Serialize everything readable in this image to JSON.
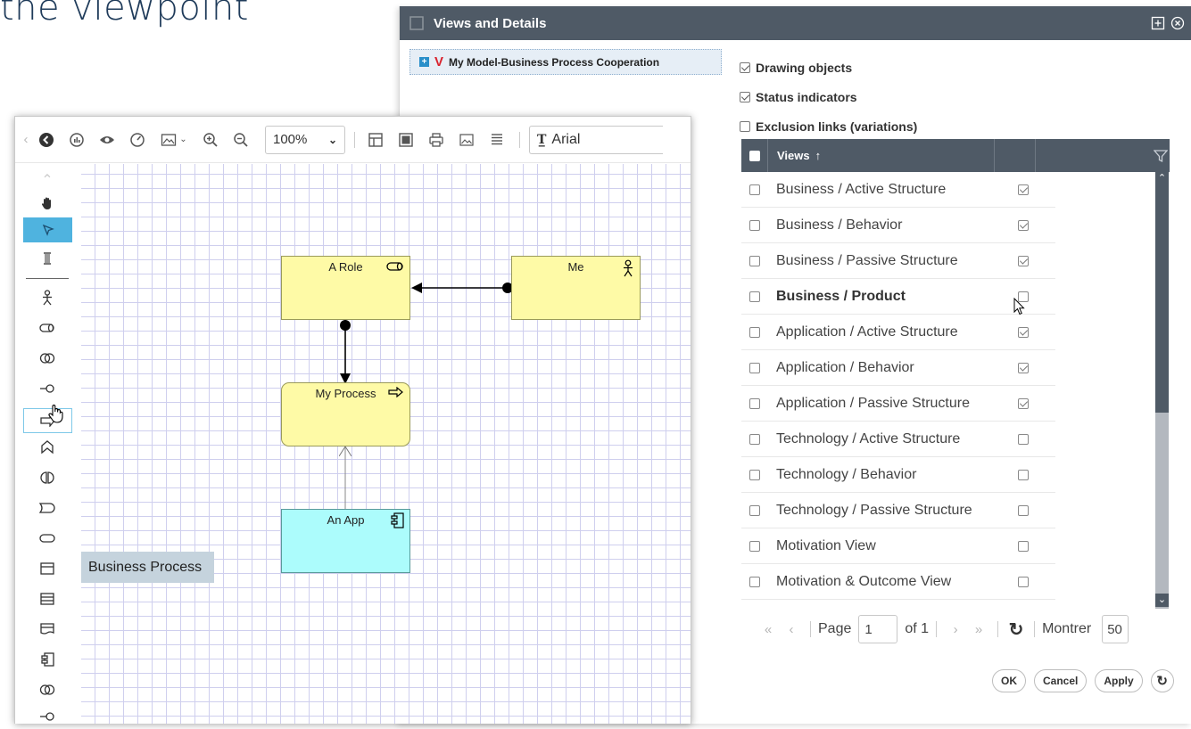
{
  "background": {
    "title_fragment": "the viewpoint"
  },
  "dialog": {
    "title": "Views and Details",
    "tree_item": "My Model-Business Process Cooperation",
    "options": [
      {
        "label": "Drawing objects",
        "checked": true
      },
      {
        "label": "Status indicators",
        "checked": true
      },
      {
        "label": "Exclusion links (variations)",
        "checked": false
      }
    ],
    "grid": {
      "column_views": "Views",
      "rows": [
        {
          "label": "Business / Active Structure",
          "checked": true,
          "bold": false
        },
        {
          "label": "Business / Behavior",
          "checked": true,
          "bold": false
        },
        {
          "label": "Business / Passive Structure",
          "checked": true,
          "bold": false
        },
        {
          "label": "Business / Product",
          "checked": false,
          "bold": true
        },
        {
          "label": "Application / Active Structure",
          "checked": true,
          "bold": false
        },
        {
          "label": "Application / Behavior",
          "checked": true,
          "bold": false
        },
        {
          "label": "Application / Passive Structure",
          "checked": true,
          "bold": false
        },
        {
          "label": "Technology / Active Structure",
          "checked": false,
          "bold": false
        },
        {
          "label": "Technology / Behavior",
          "checked": false,
          "bold": false
        },
        {
          "label": "Technology / Passive Structure",
          "checked": false,
          "bold": false
        },
        {
          "label": "Motivation View",
          "checked": false,
          "bold": false
        },
        {
          "label": "Motivation & Outcome View",
          "checked": false,
          "bold": false
        }
      ]
    },
    "pager": {
      "page_label": "Page",
      "page_value": "1",
      "of_label": "of 1",
      "show_label": "Montrer",
      "show_value": "50"
    },
    "buttons": {
      "ok": "OK",
      "cancel": "Cancel",
      "apply": "Apply"
    }
  },
  "editor": {
    "zoom": "100%",
    "font": "Arial",
    "tooltip": "Business Process",
    "nodes": {
      "role": "A Role",
      "me": "Me",
      "process": "My Process",
      "app": "An App"
    }
  }
}
